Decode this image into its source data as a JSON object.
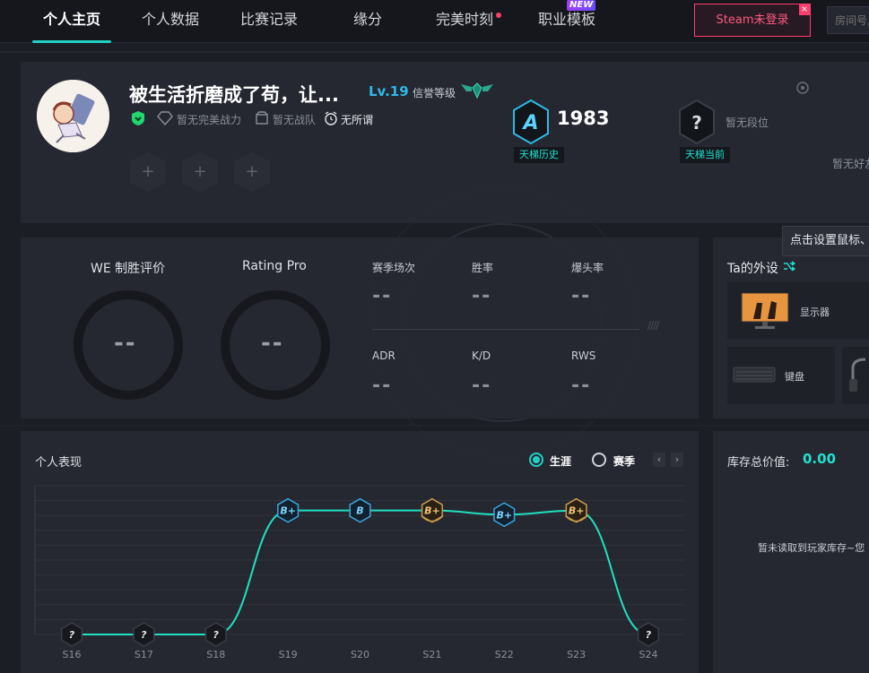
{
  "nav": {
    "tabs": [
      "个人主页",
      "个人数据",
      "比赛记录",
      "缘分",
      "完美时刻",
      "职业模板"
    ],
    "new_badge": "NEW",
    "steam_button": "Steam未登录",
    "room_placeholder": "房间号,"
  },
  "profile": {
    "username": "被生活折磨成了苟，让...",
    "level": "Lv.19",
    "credit_label": "信誉等级",
    "power": "暂无完美战力",
    "team": "暂无战队",
    "mood": "无所谓",
    "slots": [
      "+",
      "+",
      "+"
    ],
    "ladder_history_icon": "A",
    "ladder_history_score": "1983",
    "ladder_history_label": "天梯历史",
    "ladder_current_icon": "?",
    "ladder_current_text": "暂无段位",
    "ladder_current_label": "天梯当前",
    "friends_text": "暂无好友"
  },
  "stats": {
    "we_label": "WE 制胜评价",
    "we_value": "--",
    "rating_label": "Rating Pro",
    "rating_value": "--",
    "items": [
      {
        "label": "赛季场次",
        "value": "--"
      },
      {
        "label": "胜率",
        "value": "--"
      },
      {
        "label": "爆头率",
        "value": "--"
      },
      {
        "label": "ADR",
        "value": "--"
      },
      {
        "label": "K/D",
        "value": "--"
      },
      {
        "label": "RWS",
        "value": "--"
      }
    ]
  },
  "equipment": {
    "title": "Ta的外设",
    "tooltip": "点击设置鼠标、",
    "monitor": "显示器",
    "keyboard": "键盘"
  },
  "performance": {
    "title": "个人表现",
    "radio_career": "生涯",
    "radio_season": "赛季",
    "prev": "‹",
    "next": "›"
  },
  "inventory": {
    "title": "库存总价值:",
    "value": "0.00",
    "empty": "暂未读取到玩家库存~您"
  },
  "chart_data": {
    "type": "line",
    "title": "个人表现",
    "x": [
      "S16",
      "S17",
      "S18",
      "S19",
      "S20",
      "S21",
      "S22",
      "S23",
      "S24"
    ],
    "series": [
      {
        "ranks": [
          "?",
          "?",
          "?",
          "B+",
          "B",
          "B+",
          "B+",
          "B+",
          "?"
        ],
        "values": [
          0,
          0,
          0,
          3,
          3,
          3,
          2.9,
          3,
          0
        ]
      }
    ],
    "badge_styles": [
      "unknown",
      "unknown",
      "unknown",
      "blue",
      "blue",
      "gold",
      "blue",
      "gold",
      "unknown"
    ],
    "ylim": [
      0,
      3.6
    ],
    "grid": true,
    "line_color": "#21e0bf"
  }
}
